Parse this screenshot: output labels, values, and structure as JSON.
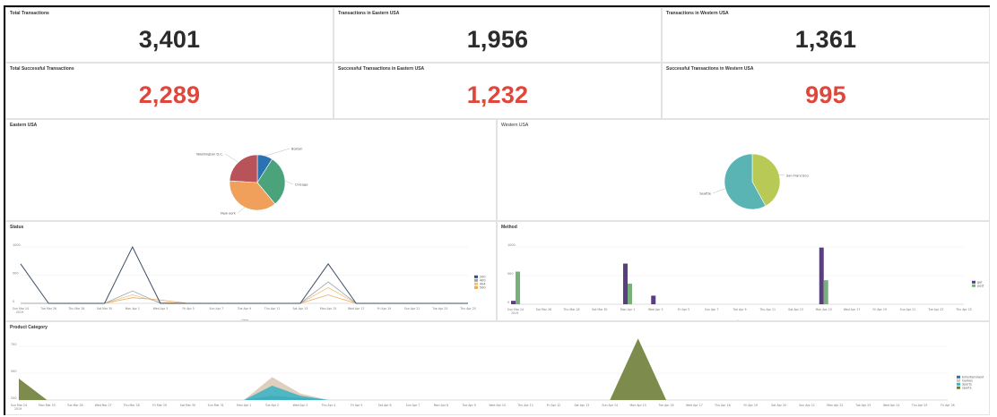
{
  "colors": {
    "red": "#e0473c",
    "dark": "#2b2b2b",
    "status_2xx": "#3c5068",
    "status_4xx": "#9aa4b0",
    "status_5xx": "#f0c27a",
    "status_5xx_b": "#e8a85a",
    "get": "#5a3f7e",
    "post": "#78b07a",
    "pie_washington": "#b8535a",
    "pie_boston": "#2b73b0",
    "pie_chicago": "#4aa37a",
    "pie_newyork": "#f0a05a",
    "pie_sanfrancisco": "#b8c955",
    "pie_seattle": "#5ab4b4",
    "area_entertainment": "#3e6ea0",
    "area_games": "#d8c7b4",
    "area_sports": "#3fb3c2",
    "area_sports2": "#6f7f3a"
  },
  "kpis": [
    {
      "title": "Total Transactions",
      "value": "3,401",
      "style": "dark"
    },
    {
      "title": "Transactions in Eastern USA",
      "value": "1,956",
      "style": "dark"
    },
    {
      "title": "Transactions in Western USA",
      "value": "1,361",
      "style": "dark"
    },
    {
      "title": "Total Successful Transactions",
      "value": "2,289",
      "style": "red"
    },
    {
      "title": "Successful Transactions in Eastern USA",
      "value": "1,232",
      "style": "red"
    },
    {
      "title": "Successful Transactions in Western USA",
      "value": "995",
      "style": "red"
    }
  ],
  "eastern": {
    "title": "Eastern USA",
    "slices": [
      {
        "label": "Boston",
        "value": 9,
        "color": "#2b73b0"
      },
      {
        "label": "Chicago",
        "value": 30,
        "color": "#4aa37a"
      },
      {
        "label": "New york",
        "value": 37,
        "color": "#f0a05a"
      },
      {
        "label": "Washington D.C.",
        "value": 24,
        "color": "#b8535a"
      }
    ]
  },
  "western": {
    "title": "Western USA",
    "slices": [
      {
        "label": "San Francisco",
        "value": 42,
        "color": "#b8c955"
      },
      {
        "label": "Seattle",
        "value": 58,
        "color": "#5ab4b4"
      }
    ]
  },
  "status": {
    "title": "Status",
    "xlabel": "_time",
    "yticks": [
      "1000",
      "500",
      "0"
    ],
    "dates": [
      "Sun Mar 24 2019",
      "Tue Mar 26",
      "Thu Mar 28",
      "Sat Mar 30",
      "Mon Apr 1",
      "Wed Apr 3",
      "Fri Apr 5",
      "Sun Apr 7",
      "Tue Apr 9",
      "Thu Apr 11",
      "Sat Apr 13",
      "Mon Apr 15",
      "Wed Apr 17",
      "Fri Apr 19",
      "Sun Apr 21",
      "Tue Apr 23",
      "Thu Apr 25"
    ],
    "legend": [
      "200",
      "400",
      "404",
      "500"
    ]
  },
  "method": {
    "title": "Method",
    "xlabel": "_time",
    "yticks": [
      "1000",
      "500",
      "0"
    ],
    "dates": [
      "Sun Mar 24 2019",
      "Tue Mar 26",
      "Thu Mar 28",
      "Sat Mar 30",
      "Mon Apr 1",
      "Wed Apr 3",
      "Fri Apr 5",
      "Sun Apr 7",
      "Tue Apr 9",
      "Thu Apr 11",
      "Sat Apr 13",
      "Mon Apr 15",
      "Wed Apr 17",
      "Fri Apr 19",
      "Sun Apr 21",
      "Tue Apr 23",
      "Thu Apr 25"
    ],
    "legend": [
      "get",
      "post"
    ]
  },
  "product": {
    "title": "Product Category",
    "xlabel": "_time",
    "yticks": [
      "750",
      "500",
      "250"
    ],
    "dates": [
      "Sun Mar 24 2019",
      "Mon Mar 25",
      "Tue Mar 26",
      "Wed Mar 27",
      "Thu Mar 28",
      "Fri Mar 29",
      "Sat Mar 30",
      "Sun Mar 31",
      "Mon Apr 1",
      "Tue Apr 2",
      "Wed Apr 3",
      "Thu Apr 4",
      "Fri Apr 5",
      "Sat Apr 6",
      "Sun Apr 7",
      "Mon Apr 8",
      "Tue Apr 9",
      "Wed Apr 10",
      "Thu Apr 11",
      "Fri Apr 12",
      "Sat Apr 13",
      "Sun Apr 14",
      "Mon Apr 15",
      "Tue Apr 16",
      "Wed Apr 17",
      "Thu Apr 18",
      "Fri Apr 19",
      "Sat Apr 20",
      "Sun Apr 21",
      "Mon Apr 22",
      "Tue Apr 23",
      "Wed Apr 24",
      "Thu Apr 25",
      "Fri Apr 26"
    ],
    "legend": [
      "Entertainment",
      "Games",
      "Sports",
      "sports"
    ]
  },
  "chart_data": [
    {
      "type": "pie",
      "title": "Eastern USA",
      "categories": [
        "Boston",
        "Chicago",
        "New york",
        "Washington D.C."
      ],
      "values": [
        9,
        30,
        37,
        24
      ]
    },
    {
      "type": "pie",
      "title": "Western USA",
      "categories": [
        "San Francisco",
        "Seattle"
      ],
      "values": [
        42,
        58
      ]
    },
    {
      "type": "line",
      "title": "Status",
      "xlabel": "_time",
      "ylim": [
        0,
        1000
      ],
      "x_index": [
        0,
        1,
        2,
        3,
        4,
        5,
        6,
        7,
        8,
        9,
        10,
        11,
        12,
        13,
        14,
        15,
        16
      ],
      "series": [
        {
          "name": "200",
          "values": [
            700,
            0,
            0,
            0,
            1000,
            0,
            0,
            0,
            0,
            0,
            0,
            700,
            0,
            0,
            0,
            0,
            0
          ]
        },
        {
          "name": "400",
          "values": [
            0,
            0,
            0,
            0,
            220,
            0,
            0,
            0,
            0,
            0,
            0,
            380,
            0,
            0,
            0,
            0,
            0
          ]
        },
        {
          "name": "404",
          "values": [
            0,
            0,
            0,
            0,
            150,
            20,
            0,
            0,
            0,
            0,
            0,
            280,
            0,
            0,
            0,
            0,
            0
          ]
        },
        {
          "name": "500",
          "values": [
            0,
            0,
            0,
            0,
            100,
            60,
            0,
            0,
            0,
            0,
            0,
            150,
            0,
            0,
            0,
            0,
            0
          ]
        }
      ]
    },
    {
      "type": "bar",
      "title": "Method",
      "xlabel": "_time",
      "ylim": [
        0,
        1000
      ],
      "x_index": [
        0,
        1,
        2,
        3,
        4,
        5,
        6,
        7,
        8,
        9,
        10,
        11,
        12,
        13,
        14,
        15,
        16
      ],
      "series": [
        {
          "name": "get",
          "values": [
            60,
            0,
            0,
            0,
            710,
            150,
            0,
            0,
            0,
            0,
            0,
            990,
            0,
            0,
            0,
            0,
            0
          ]
        },
        {
          "name": "post",
          "values": [
            570,
            0,
            0,
            0,
            360,
            0,
            0,
            0,
            0,
            0,
            0,
            420,
            0,
            0,
            0,
            0,
            0
          ]
        }
      ]
    },
    {
      "type": "area",
      "title": "Product Category",
      "xlabel": "_time",
      "ylim": [
        0,
        1000
      ],
      "x_index": [
        0,
        1,
        2,
        3,
        4,
        5,
        6,
        7,
        8,
        9,
        10,
        11,
        12,
        13,
        14,
        15,
        16,
        17,
        18,
        19,
        20,
        21,
        22,
        23,
        24,
        25,
        26,
        27,
        28,
        29,
        30,
        31,
        32,
        33
      ],
      "series": [
        {
          "name": "Entertainment",
          "values": [
            0,
            0,
            0,
            0,
            0,
            0,
            0,
            0,
            0,
            60,
            30,
            0,
            0,
            0,
            0,
            0,
            0,
            0,
            0,
            0,
            0,
            0,
            0,
            0,
            0,
            0,
            0,
            0,
            0,
            0,
            0,
            0,
            0,
            0
          ]
        },
        {
          "name": "Games",
          "values": [
            0,
            0,
            0,
            0,
            0,
            0,
            0,
            0,
            0,
            320,
            90,
            0,
            0,
            0,
            0,
            0,
            0,
            0,
            0,
            0,
            0,
            0,
            0,
            0,
            0,
            0,
            0,
            0,
            0,
            0,
            0,
            0,
            0,
            0
          ]
        },
        {
          "name": "Sports",
          "values": [
            0,
            0,
            0,
            0,
            0,
            0,
            0,
            0,
            0,
            200,
            60,
            0,
            0,
            0,
            0,
            0,
            0,
            0,
            0,
            0,
            0,
            0,
            0,
            0,
            0,
            0,
            0,
            0,
            0,
            0,
            0,
            0,
            0,
            0
          ]
        },
        {
          "name": "sports",
          "values": [
            300,
            0,
            0,
            0,
            0,
            0,
            0,
            0,
            0,
            0,
            0,
            0,
            0,
            0,
            0,
            0,
            0,
            0,
            0,
            0,
            0,
            0,
            860,
            0,
            0,
            0,
            0,
            0,
            0,
            0,
            0,
            0,
            0,
            0
          ]
        }
      ]
    }
  ]
}
